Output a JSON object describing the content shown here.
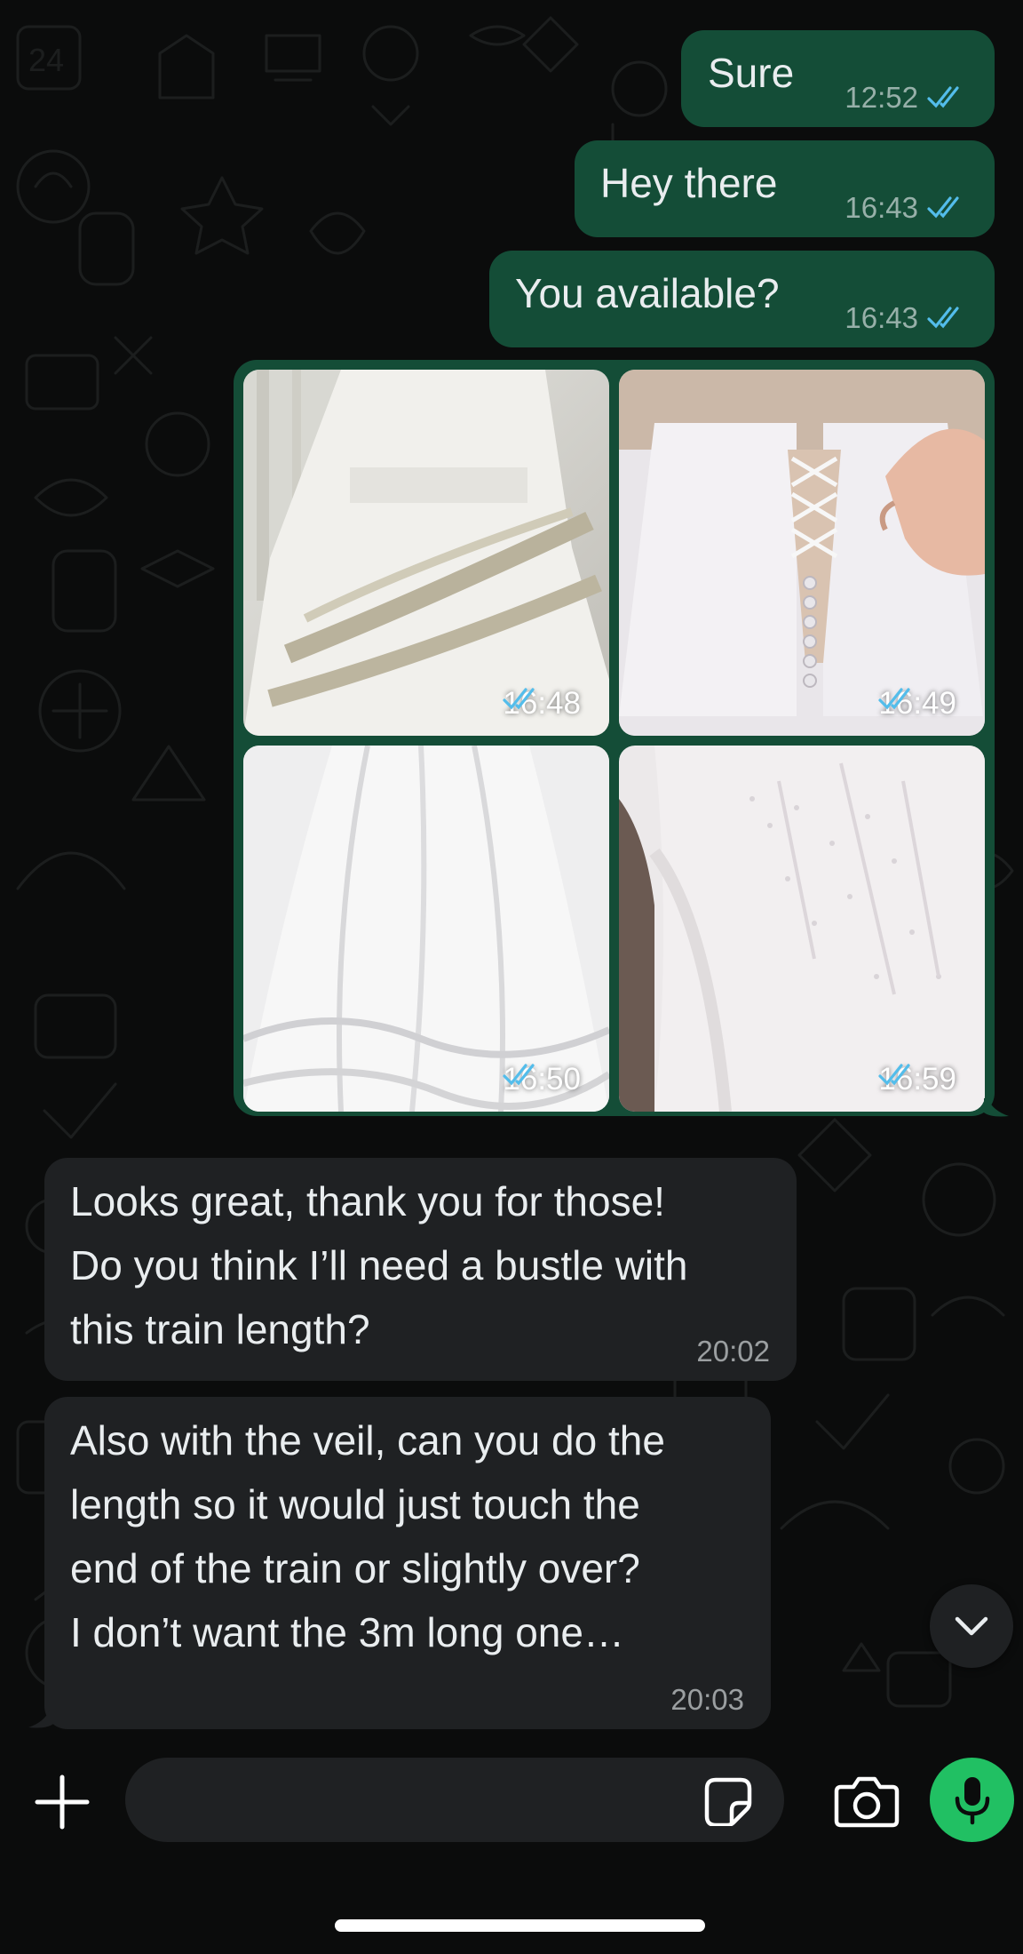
{
  "colors": {
    "background": "#0b0c0c",
    "outgoing_bubble": "#144d37",
    "incoming_bubble": "#1f2123",
    "read_ticks": "#53bdeb",
    "mic_button": "#21c063"
  },
  "messages": [
    {
      "direction": "outgoing",
      "text": "Sure",
      "time": "12:52",
      "status": "read"
    },
    {
      "direction": "outgoing",
      "text": "Hey there",
      "time": "16:43",
      "status": "read"
    },
    {
      "direction": "outgoing",
      "text": "You available?",
      "time": "16:43",
      "status": "read"
    }
  ],
  "album": {
    "photos": [
      {
        "time": "16:48",
        "status": "read",
        "subject": "white dress draped skirt"
      },
      {
        "time": "16:49",
        "status": "read",
        "subject": "corset back with buttons"
      },
      {
        "time": "16:50",
        "status": "read",
        "subject": "dress train on floor"
      },
      {
        "time": "16:59",
        "status": "read",
        "subject": "sparkly bodice detail"
      }
    ]
  },
  "incoming": [
    {
      "text": "Looks great, thank you for those!\nDo you think I’ll need a bustle with\nthis train length?",
      "time": "20:02"
    },
    {
      "text": "Also with the veil, can you do the\nlength so it would just touch the\nend of the train or slightly over?\nI don’t want the 3m long one…",
      "time": "20:03"
    }
  ],
  "composer": {
    "placeholder": "",
    "icons": [
      "plus-icon",
      "sticker-icon",
      "camera-icon",
      "microphone-icon"
    ]
  },
  "scroll_down": {
    "icon": "chevron-down-icon"
  }
}
